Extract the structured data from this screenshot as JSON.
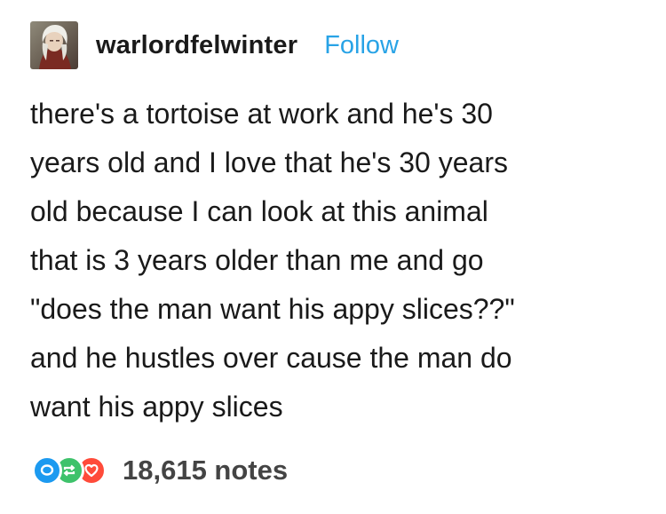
{
  "post": {
    "author": "warlordfelwinter",
    "follow_label": "Follow",
    "body_lines": [
      "there's a tortoise at work and he's 30",
      "years old and I love that he's 30 years",
      "old because I can look at this animal",
      "that is 3 years older than me and go",
      "\"does the man want his appy slices??\"",
      "and he hustles over cause the man do",
      "want his appy slices"
    ],
    "notes": "18,615 notes",
    "reaction_icons": [
      "reply-icon",
      "reblog-icon",
      "like-icon"
    ]
  },
  "colors": {
    "follow": "#28a3e6",
    "reply": "#1c9af0",
    "reblog": "#3ec26b",
    "like": "#ff4b3a",
    "text": "#1a1a1a"
  }
}
